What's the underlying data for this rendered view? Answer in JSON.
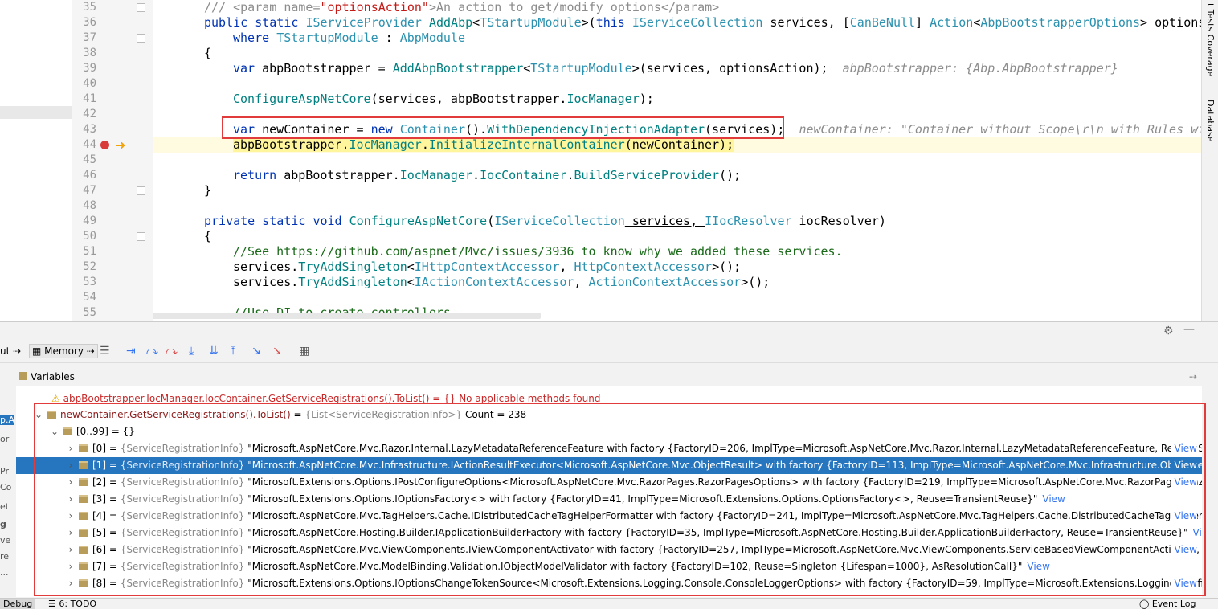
{
  "editor": {
    "line_numbers": [
      "35",
      "36",
      "37",
      "38",
      "39",
      "40",
      "41",
      "42",
      "43",
      "44",
      "45",
      "46",
      "47",
      "48",
      "49",
      "50",
      "51",
      "52",
      "53",
      "54",
      "55"
    ],
    "lines": {
      "l35a": "/// <param name=",
      "l35b": "\"optionsAction\"",
      "l35c": ">An action to get/modify options</param>",
      "l36a": "public static ",
      "l36b": "IServiceProvider ",
      "l36c": "AddAbp",
      "l36d": "<",
      "l36e": "TStartupModule",
      "l36f": ">(",
      "l36g": "this ",
      "l36h": "IServiceCollection",
      "l36i": " services, [",
      "l36j": "CanBeNull",
      "l36k": "] ",
      "l36l": "Action",
      "l36m": "<",
      "l36n": "AbpBootstrapperOptions",
      "l36o": "> options",
      "l37a": "where ",
      "l37b": "TStartupModule",
      "l37c": " : ",
      "l37d": "AbpModule",
      "l38": "{",
      "l39a": "var ",
      "l39b": "abpBootstrapper = ",
      "l39c": "AddAbpBootstrapper",
      "l39d": "<",
      "l39e": "TStartupModule",
      "l39f": ">(services, optionsAction);",
      "l39hint": "abpBootstrapper: {Abp.AbpBootstrapper}",
      "l41a": "ConfigureAspNetCore",
      "l41b": "(services, abpBootstrapper.",
      "l41c": "IocManager",
      "l41d": ");",
      "l43a": "var ",
      "l43b": "newContainer = ",
      "l43c": "new ",
      "l43d": "Container",
      "l43e": "().",
      "l43f": "WithDependencyInjectionAdapter",
      "l43g": "(services);",
      "l43hint": "newContainer: \"Container without Scope\\r\\n with Rules wi",
      "l44a": "abpBootstrapper.",
      "l44b": "IocManager",
      "l44c": ".",
      "l44d": "InitializeInternalContainer",
      "l44e": "(newContainer);",
      "l46a": "return ",
      "l46b": "abpBootstrapper.",
      "l46c": "IocManager",
      "l46d": ".",
      "l46e": "IocContainer",
      "l46f": ".",
      "l46g": "BuildServiceProvider",
      "l46h": "();",
      "l47": "}",
      "l49a": "private static void ",
      "l49b": "ConfigureAspNetCore",
      "l49c": "(",
      "l49d": "IServiceCollection",
      "l49e": " services, ",
      "l49f": "IIocResolver",
      "l49g": " iocResolver)",
      "l50": "{",
      "l51": "//See https://github.com/aspnet/Mvc/issues/3936 to know why we added these services.",
      "l52a": "services.",
      "l52b": "TryAddSingleton",
      "l52c": "<",
      "l52d": "IHttpContextAccessor",
      "l52e": ", ",
      "l52f": "HttpContextAccessor",
      "l52g": ">();",
      "l53a": "services.",
      "l53b": "TryAddSingleton",
      "l53c": "<",
      "l53d": "IActionContextAccessor",
      "l53e": ", ",
      "l53f": "ActionContextAccessor",
      "l53g": ">();",
      "l55": "//Use DI to create controllers"
    }
  },
  "right_strip": {
    "tab1": "t Tests Coverage",
    "tab2": "Database"
  },
  "debug_toolbar": {
    "tab_out": "ut",
    "tab_memory": "Memory"
  },
  "variables": {
    "header": "Variables",
    "warning_row": "abpBootstrapper.IocManager.IocContainer.GetServiceRegistrations().ToList() = {} No applicable methods found",
    "root": {
      "name": "newContainer.GetServiceRegistrations().ToList()",
      "eq": " = ",
      "type": "{List<ServiceRegistrationInfo>}",
      "count": " Count = 238"
    },
    "group": {
      "name": "[0..99]",
      "value": " = {}"
    },
    "items": [
      {
        "idx": "[0]",
        "type": "{ServiceRegistrationInfo}",
        "value": "\"Microsoft.AspNetCore.Mvc.Razor.Internal.LazyMetadataReferenceFeature with factory {FactoryID=206, ImplType=Microsoft.AspNetCore.Mvc.Razor.Internal.LazyMetadataReferenceFeature, Reuse=Sing"
      },
      {
        "idx": "[1]",
        "type": "{ServiceRegistrationInfo}",
        "value": "\"Microsoft.AspNetCore.Mvc.Infrastructure.IActionResultExecutor<Microsoft.AspNetCore.Mvc.ObjectResult> with factory {FactoryID=113, ImplType=Microsoft.AspNetCore.Mvc.Infrastructure.ObjectResu"
      },
      {
        "idx": "[2]",
        "type": "{ServiceRegistrationInfo}",
        "value": "\"Microsoft.Extensions.Options.IPostConfigureOptions<Microsoft.AspNetCore.Mvc.RazorPages.RazorPagesOptions> with factory {FactoryID=219, ImplType=Microsoft.AspNetCore.Mvc.RazorPages.Raz"
      },
      {
        "idx": "[3]",
        "type": "{ServiceRegistrationInfo}",
        "value": "\"Microsoft.Extensions.Options.IOptionsFactory<> with factory {FactoryID=41, ImplType=Microsoft.Extensions.Options.OptionsFactory<>, Reuse=TransientReuse}\""
      },
      {
        "idx": "[4]",
        "type": "{ServiceRegistrationInfo}",
        "value": "\"Microsoft.AspNetCore.Mvc.TagHelpers.Cache.IDistributedCacheTagHelperFormatter with factory {FactoryID=241, ImplType=Microsoft.AspNetCore.Mvc.TagHelpers.Cache.DistributedCacheTagHelperF"
      },
      {
        "idx": "[5]",
        "type": "{ServiceRegistrationInfo}",
        "value": "\"Microsoft.AspNetCore.Hosting.Builder.IApplicationBuilderFactory with factory {FactoryID=35, ImplType=Microsoft.AspNetCore.Hosting.Builder.ApplicationBuilderFactory, Reuse=TransientReuse}\""
      },
      {
        "idx": "[6]",
        "type": "{ServiceRegistrationInfo}",
        "value": "\"Microsoft.AspNetCore.Mvc.ViewComponents.IViewComponentActivator with factory {FactoryID=257, ImplType=Microsoft.AspNetCore.Mvc.ViewComponents.ServiceBasedViewComponentActivator, Re"
      },
      {
        "idx": "[7]",
        "type": "{ServiceRegistrationInfo}",
        "value": "\"Microsoft.AspNetCore.Mvc.ModelBinding.Validation.IObjectModelValidator with factory {FactoryID=102, Reuse=Singleton {Lifespan=1000}, AsResolutionCall}\""
      },
      {
        "idx": "[8]",
        "type": "{ServiceRegistrationInfo}",
        "value": "\"Microsoft.Extensions.Options.IOptionsChangeTokenSource<Microsoft.Extensions.Logging.Console.ConsoleLoggerOptions> with factory {FactoryID=59, ImplType=Microsoft.Extensions.Logging.Config"
      }
    ],
    "view_label": "View"
  },
  "left_panel_fragments": [
    "p.A",
    "or",
    "Pr",
    "Co",
    "et",
    "g",
    "ve",
    "re",
    "..."
  ],
  "statusbar": {
    "debug": "Debug",
    "todo": "6: TODO",
    "event_log": "Event Log"
  },
  "colors": {
    "selection": "#2675bf",
    "highlight_box": "#e23b3b",
    "current_line": "#fffbe0"
  }
}
